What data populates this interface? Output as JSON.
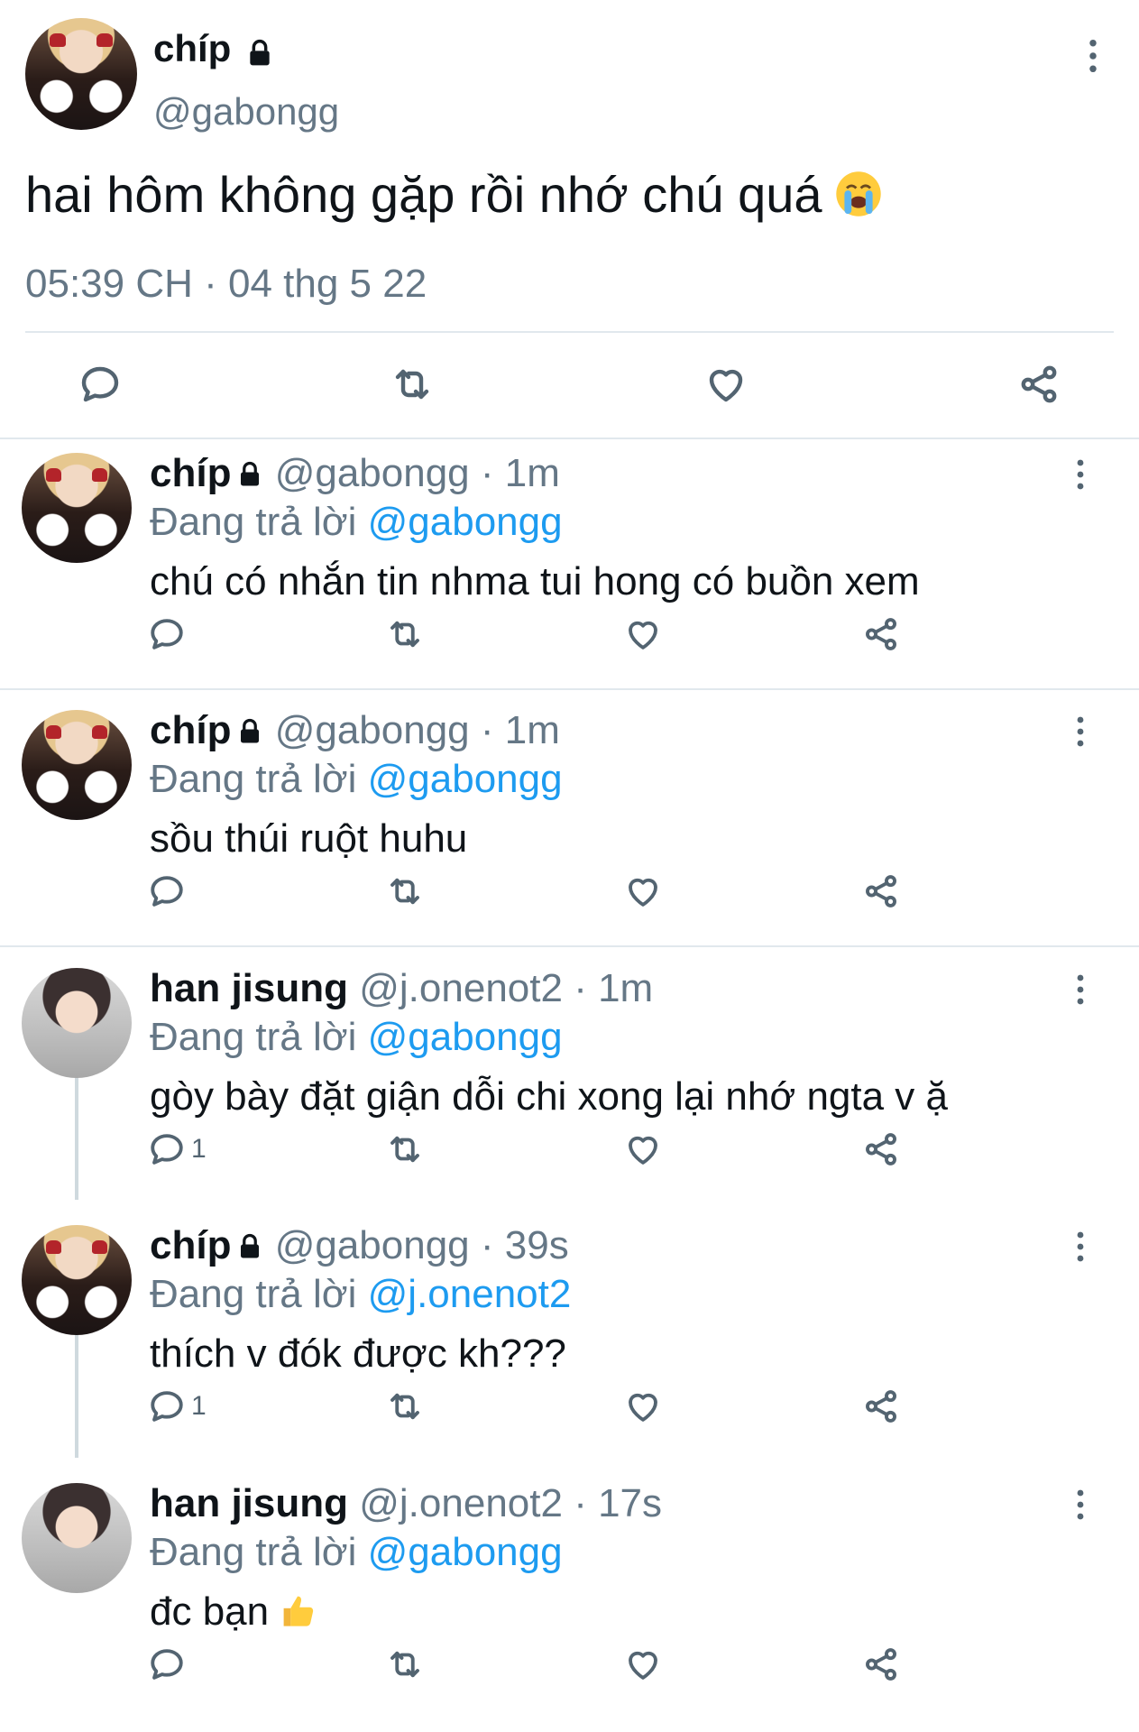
{
  "main_tweet": {
    "name": "chíp",
    "handle": "@gabongg",
    "text": "hai hôm không gặp rồi nhớ chú quá",
    "timestamp": "05:39 CH · 04 thg 5 22",
    "emoji": "loudly-crying-face",
    "icons": [
      "reply-icon",
      "retweet-icon",
      "like-icon",
      "share-icon"
    ]
  },
  "replies": [
    {
      "name": "chíp",
      "locked": true,
      "handle": "@gabongg",
      "time": "1m",
      "replying_label": "Đang trả lời",
      "replying_to": "@gabongg",
      "text": "chú có nhắn tin nhma tui hong có buồn xem",
      "reply_count": ""
    },
    {
      "name": "chíp",
      "locked": true,
      "handle": "@gabongg",
      "time": "1m",
      "replying_label": "Đang trả lời",
      "replying_to": "@gabongg",
      "text": "sồu thúi ruột huhu",
      "reply_count": ""
    },
    {
      "name": "han jisung",
      "locked": false,
      "handle": "@j.onenot2",
      "time": "1m",
      "replying_label": "Đang trả lời",
      "replying_to": "@gabongg",
      "text": "gòy bày đặt giận dỗi chi xong lại nhớ ngta v ặ",
      "reply_count": "1"
    },
    {
      "name": "chíp",
      "locked": true,
      "handle": "@gabongg",
      "time": "39s",
      "replying_label": "Đang trả lời",
      "replying_to": "@j.onenot2",
      "text": "thích v đók được kh???",
      "reply_count": "1"
    },
    {
      "name": "han jisung",
      "locked": false,
      "handle": "@j.onenot2",
      "time": "17s",
      "replying_label": "Đang trả lời",
      "replying_to": "@gabongg",
      "text": "đc bạn",
      "reply_count": "",
      "emoji": "thumbs-up"
    }
  ],
  "colors": {
    "link": "#1d9bf0",
    "secondary": "#657786",
    "divider": "#e1e8ed"
  }
}
